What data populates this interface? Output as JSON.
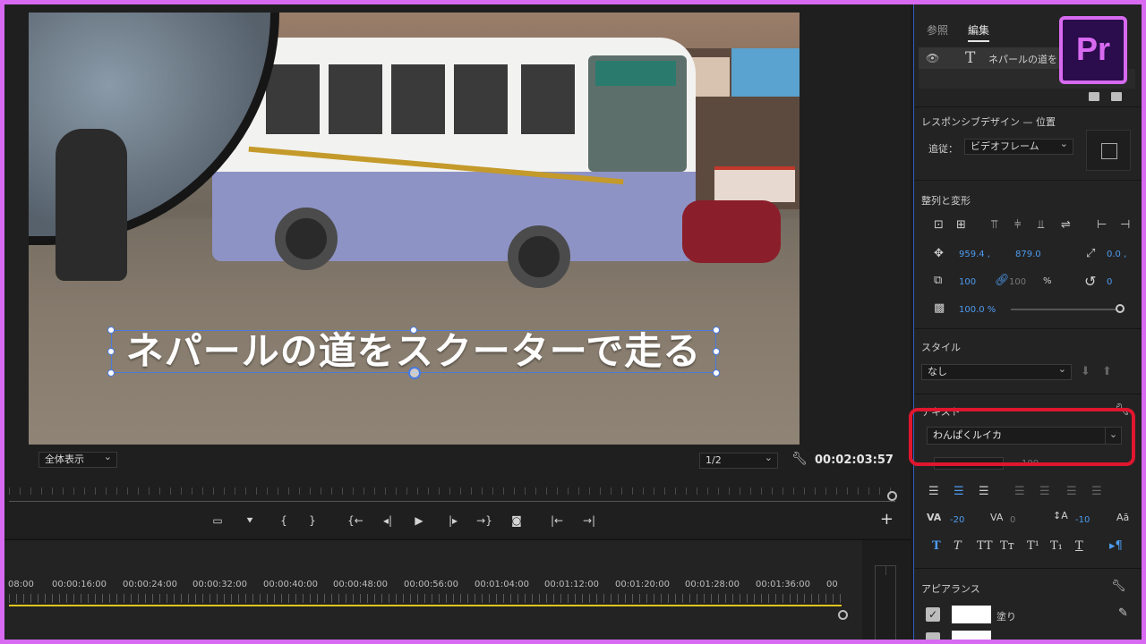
{
  "app": {
    "logo": "Pr"
  },
  "monitor": {
    "caption": "ネパールの道をスクーターで走る",
    "zoom": "全体表示",
    "resolution": "1/2",
    "timecode": "00:02:03:57"
  },
  "transport": {
    "buttons": [
      "safe-margins",
      "add-marker",
      "mark-in",
      "mark-out",
      "go-to-in",
      "step-back",
      "play",
      "step-forward",
      "go-to-out",
      "export-frame",
      "lift",
      "extract"
    ],
    "plus": "+"
  },
  "timeline": {
    "ruler_labels": [
      "08:00",
      "00:00:16:00",
      "00:00:24:00",
      "00:00:32:00",
      "00:00:40:00",
      "00:00:48:00",
      "00:00:56:00",
      "00:01:04:00",
      "00:01:12:00",
      "00:01:20:00",
      "00:01:28:00",
      "00:01:36:00",
      "00"
    ]
  },
  "panel": {
    "tabs": [
      "参照",
      "編集"
    ],
    "active_tab": "編集",
    "layer_name": "ネパールの道を",
    "responsive_title": "レスポンシブデザイン — 位置",
    "follow_label": "追従：",
    "follow_value": "ビデオフレーム",
    "align_title": "整列と変形",
    "pos_x": "959.4 ,",
    "pos_y": "879.0",
    "anchor_val": "0.0 ,",
    "scale": "100",
    "scale_locked": "100",
    "percent": "%",
    "rotation": "0",
    "opacity": "100.0 %",
    "style_title": "スタイル",
    "style_value": "なし",
    "text_title": "テキスト",
    "font_value": "わんぱくルイカ",
    "font_size": "100",
    "kerning": "-20",
    "tracking": "0",
    "leading": "-10",
    "appearance_title": "アピアランス",
    "fill_label": "塗り",
    "accent": "#4d9bf0",
    "highlight_color": "#e0162f",
    "frame_color": "#d76af0"
  }
}
